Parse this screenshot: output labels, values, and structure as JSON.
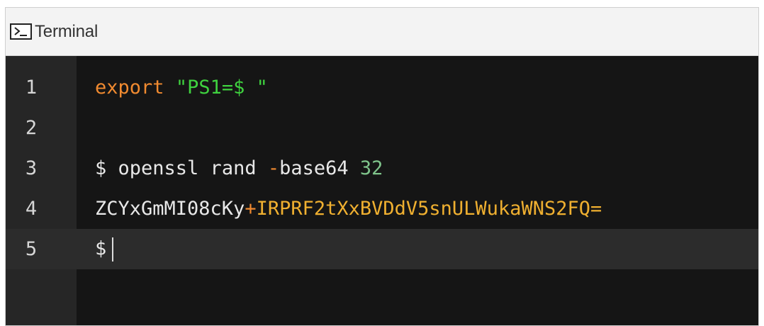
{
  "window": {
    "title": "Terminal",
    "icon": "terminal-icon"
  },
  "colors": {
    "keyword": "#f08a30",
    "string": "#3fd23f",
    "number": "#7fc48b",
    "highlight": "#f0b030",
    "background": "#151515"
  },
  "lines": [
    {
      "number": "1",
      "keyword": "export",
      "string": "\"PS1=$ \""
    },
    {
      "number": "2"
    },
    {
      "number": "3",
      "prompt": "$ ",
      "command": "openssl rand ",
      "flag": "-base64 ",
      "arg": "32"
    },
    {
      "number": "4",
      "plain": "ZCYxGmMI08cKy",
      "plus": "+",
      "rest": "IRPRF2tXxBVDdV5snULWukaWNS2FQ="
    },
    {
      "number": "5",
      "prompt": "$",
      "active": true
    }
  ]
}
